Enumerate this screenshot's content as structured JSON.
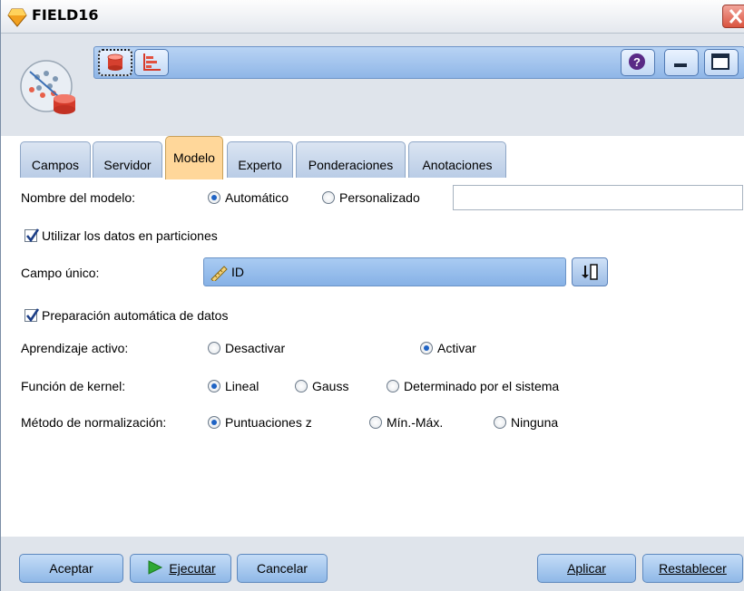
{
  "window": {
    "title": "FIELD16"
  },
  "toolbar": {
    "icons": [
      "database-icon",
      "chart-icon",
      "help-icon",
      "minimize-icon",
      "maximize-icon"
    ]
  },
  "tabs": [
    {
      "label": "Campos"
    },
    {
      "label": "Servidor"
    },
    {
      "label": "Modelo",
      "active": true
    },
    {
      "label": "Experto"
    },
    {
      "label": "Ponderaciones"
    },
    {
      "label": "Anotaciones"
    }
  ],
  "form": {
    "model_name": {
      "label": "Nombre del modelo:",
      "opt_auto": "Automático",
      "opt_custom": "Personalizado",
      "selected": "Automático",
      "value": ""
    },
    "use_partitions": {
      "label": "Utilizar los datos en particiones",
      "checked": true
    },
    "unique_field": {
      "label": "Campo único:",
      "value": "ID"
    },
    "auto_prep": {
      "label": "Preparación automática de datos",
      "checked": true
    },
    "active_learning": {
      "label": "Aprendizaje activo:",
      "opt_off": "Desactivar",
      "opt_on": "Activar",
      "selected": "Activar"
    },
    "kernel": {
      "label": "Función de kernel:",
      "opt_linear": "Lineal",
      "opt_gauss": "Gauss",
      "opt_system": "Determinado por el sistema",
      "selected": "Lineal"
    },
    "normalization": {
      "label": "Método de normalización:",
      "opt_z": "Puntuaciones z",
      "opt_minmax": "Mín.-Máx.",
      "opt_none": "Ninguna",
      "selected": "Puntuaciones z"
    }
  },
  "buttons": {
    "ok": "Aceptar",
    "run": "Ejecutar",
    "cancel": "Cancelar",
    "apply": "Aplicar",
    "reset": "Restablecer"
  },
  "colors": {
    "active_tab": "#ffd79a",
    "button_blue": "#8fb8e7",
    "header_bg": "#dfe4eb",
    "close_red": "#d9533f"
  }
}
